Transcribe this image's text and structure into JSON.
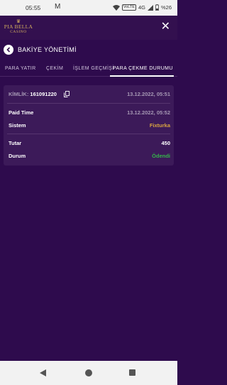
{
  "status_bar": {
    "time": "05:55",
    "mail_icon": "M",
    "volte": "VoLTE",
    "network": "4G",
    "battery": "%26"
  },
  "app": {
    "logo_line1": "PIA BELLA",
    "logo_line2": "CASINO",
    "close": "✕"
  },
  "page": {
    "title": "BAKİYE YÖNETİMİ"
  },
  "tabs": [
    {
      "label": "PARA YATIR",
      "active": false
    },
    {
      "label": "ÇEKİM",
      "active": false
    },
    {
      "label": "İŞLEM GEÇMİŞİ",
      "active": false
    },
    {
      "label": "PARA ÇEKME DURUMU",
      "active": true
    }
  ],
  "withdrawal": {
    "id_label": "KİMLİK:",
    "id_value": "161091220",
    "created_at": "13.12.2022, 05:51",
    "paid_time_label": "Paid Time",
    "paid_time_value": "13.12.2022, 05:52",
    "system_label": "Sistem",
    "system_value": "Fixturka",
    "amount_label": "Tutar",
    "amount_value": "450",
    "status_label": "Durum",
    "status_value": "Ödendi"
  },
  "colors": {
    "background": "#2e0b4d",
    "card": "#3c1a59",
    "system_value": "#d9a441",
    "status_paid": "#35b44a"
  }
}
